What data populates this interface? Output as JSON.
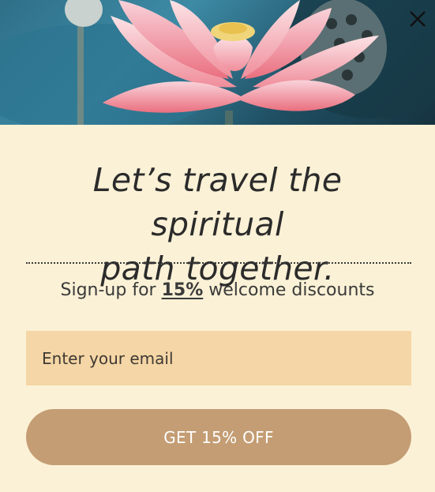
{
  "hero": {
    "image": "lotus-flower-photo"
  },
  "close": {
    "icon": "close-icon"
  },
  "headline": {
    "line1": "Let’s travel the spiritual",
    "line2": "path together."
  },
  "subtitle": {
    "prefix": "Sign-up for",
    "highlight": "15%",
    "suffix": "welcome discounts"
  },
  "email": {
    "placeholder": "Enter your email",
    "value": ""
  },
  "cta": {
    "label": "GET 15% OFF"
  },
  "colors": {
    "background": "#fbf1d6",
    "input": "#f5d6a6",
    "button": "#c49d74"
  }
}
